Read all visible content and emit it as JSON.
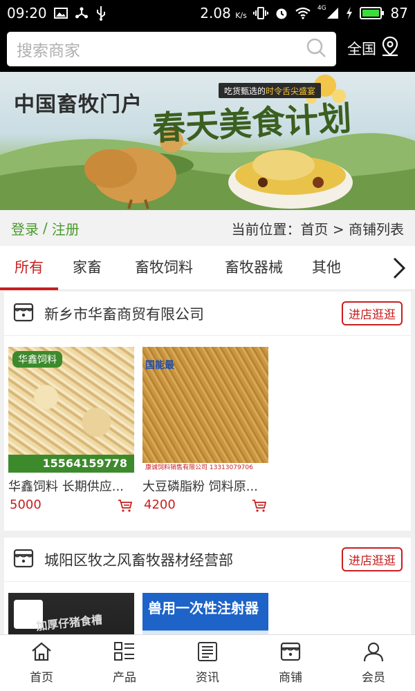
{
  "status_bar": {
    "time": "09:20",
    "speed": "2.08",
    "speed_unit": "K/s",
    "network": "4G",
    "battery": "87"
  },
  "search": {
    "placeholder": "搜索商家",
    "region_label": "全国"
  },
  "banner": {
    "portal_name": "中国畜牧门户",
    "tagline_prefix": "吃货甄选的",
    "tagline_highlight": "时令舌尖盛宴",
    "title": "春天美食计划"
  },
  "breadcrumb": {
    "login": "登录",
    "separator": "/",
    "register": "注册",
    "location": "当前位置：首页 > 商铺列表"
  },
  "categories": [
    {
      "label": "所有",
      "active": true
    },
    {
      "label": "家畜",
      "active": false
    },
    {
      "label": "畜牧饲料",
      "active": false
    },
    {
      "label": "畜牧器械",
      "active": false
    },
    {
      "label": "其他",
      "active": false
    }
  ],
  "shops": [
    {
      "name": "新乡市华畜商贸有限公司",
      "visit_label": "进店逛逛",
      "products": [
        {
          "name": "华鑫饲料 长期供应...",
          "price": "5000",
          "image_tag": "华鑫饲料",
          "image_phone": "15564159778"
        },
        {
          "name": "大豆磷脂粉 饲料原...",
          "price": "4200",
          "image_header": "国能最",
          "image_footer": "康诚饲料销售有限公司 13313079706"
        }
      ]
    },
    {
      "name": "城阳区牧之风畜牧器材经营部",
      "visit_label": "进店逛逛",
      "products": [
        {
          "name": "",
          "price": "",
          "image_text": "加厚仔猪食槽"
        },
        {
          "name": "",
          "price": "",
          "image_text": "兽用一次性注射器"
        }
      ]
    }
  ],
  "bottom_nav": [
    {
      "label": "首页",
      "icon": "home-icon"
    },
    {
      "label": "产品",
      "icon": "grid-list-icon"
    },
    {
      "label": "资讯",
      "icon": "news-icon"
    },
    {
      "label": "商铺",
      "icon": "shop-icon"
    },
    {
      "label": "会员",
      "icon": "user-icon"
    }
  ],
  "colors": {
    "accent": "#c81e1e",
    "login_green": "#4a9a2c",
    "header_bg": "#000000"
  }
}
